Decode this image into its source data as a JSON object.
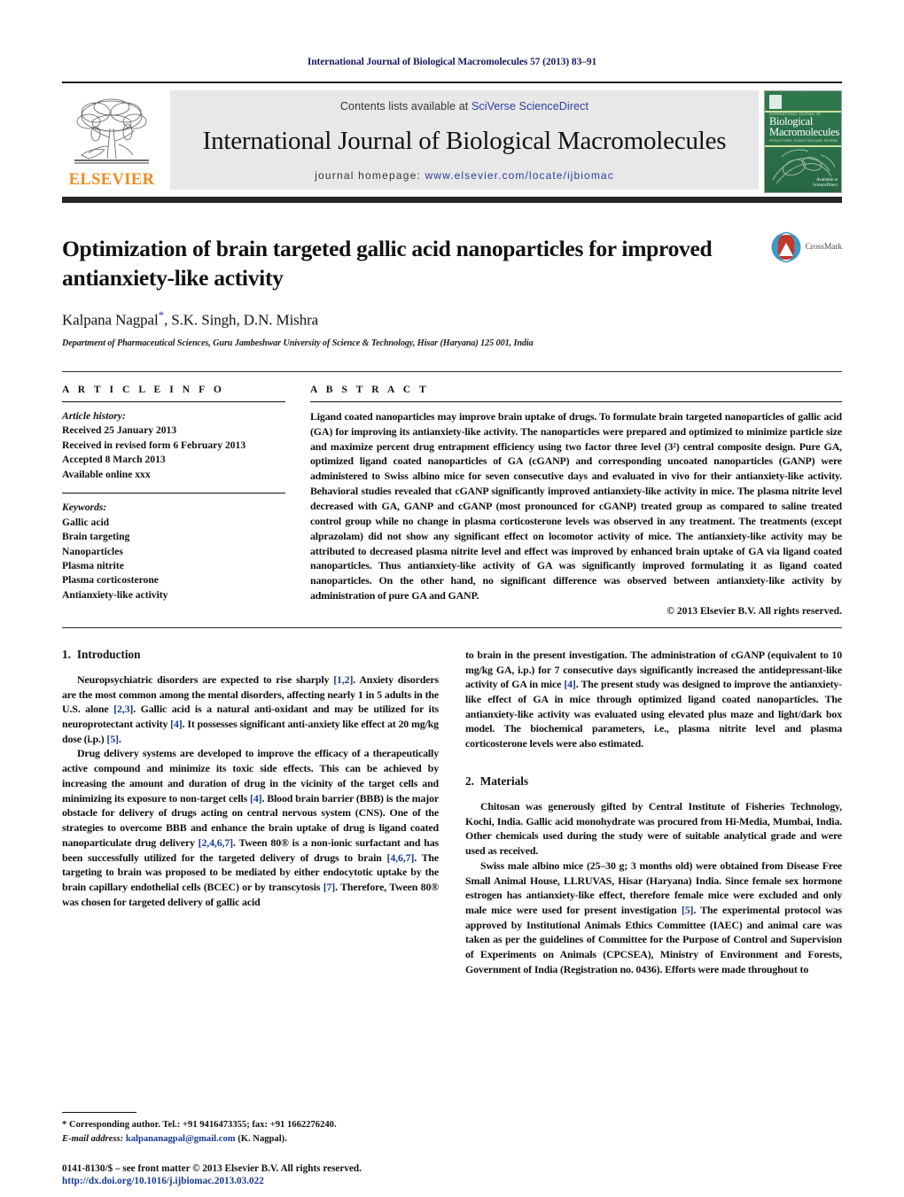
{
  "running_head": "International Journal of Biological Macromolecules 57 (2013) 83–91",
  "masthead": {
    "publisher_name": "ELSEVIER",
    "contents_prefix": "Contents lists available at ",
    "contents_link": "SciVerse ScienceDirect",
    "journal_title": "International Journal of Biological Macromolecules",
    "homepage_prefix": "journal homepage: ",
    "homepage_link": "www.elsevier.com/locate/ijbiomac",
    "cover": {
      "top_line": "INTERNATIONAL JOURNAL OF",
      "name_line1": "Biological",
      "name_line2": "Macromolecules",
      "sub_line": "STRUCTURE, FUNCTION AND INTERACTIONS",
      "badge_line1": "Available at",
      "badge_line2": "ScienceDirect"
    }
  },
  "article": {
    "title": "Optimization of brain targeted gallic acid nanoparticles for improved antianxiety-like activity",
    "authors_pre": "Kalpana Nagpal",
    "authors_post": ", S.K. Singh, D.N. Mishra",
    "affiliation": "Department of Pharmaceutical Sciences, Guru Jambeshwar University of Science & Technology, Hisar (Haryana) 125 001, India",
    "crossmark_label": "CrossMark"
  },
  "article_info": {
    "heading": "A R T I C L E   I N F O",
    "history_label": "Article history:",
    "history": [
      "Received 25 January 2013",
      "Received in revised form 6 February 2013",
      "Accepted 8 March 2013",
      "Available online xxx"
    ],
    "keywords_label": "Keywords:",
    "keywords": [
      "Gallic acid",
      "Brain targeting",
      "Nanoparticles",
      "Plasma nitrite",
      "Plasma corticosterone",
      "Antianxiety-like activity"
    ]
  },
  "abstract": {
    "heading": "A B S T R A C T",
    "text": "Ligand coated nanoparticles may improve brain uptake of drugs. To formulate brain targeted nanoparticles of gallic acid (GA) for improving its antianxiety-like activity. The nanoparticles were prepared and optimized to minimize particle size and maximize percent drug entrapment efficiency using two factor three level (3²) central composite design. Pure GA, optimized ligand coated nanoparticles of GA (cGANP) and corresponding uncoated nanoparticles (GANP) were administered to Swiss albino mice for seven consecutive days and evaluated in vivo for their antianxiety-like activity. Behavioral studies revealed that cGANP significantly improved antianxiety-like activity in mice. The plasma nitrite level decreased with GA, GANP and cGANP (most pronounced for cGANP) treated group as compared to saline treated control group while no change in plasma corticosterone levels was observed in any treatment. The treatments (except alprazolam) did not show any significant effect on locomotor activity of mice. The antianxiety-like activity may be attributed to decreased plasma nitrite level and effect was improved by enhanced brain uptake of GA via ligand coated nanoparticles. Thus antianxiety-like activity of GA was significantly improved formulating it as ligand coated nanoparticles. On the other hand, no significant difference was observed between antianxiety-like activity by administration of pure GA and GANP.",
    "copyright": "© 2013 Elsevier B.V. All rights reserved."
  },
  "sections": {
    "introduction": {
      "number": "1.",
      "title": "Introduction",
      "p1_a": "Neuropsychiatric disorders are expected to rise sharply ",
      "p1_r1": "[1,2]",
      "p1_b": ". Anxiety disorders are the most common among the mental disorders, affecting nearly 1 in 5 adults in the U.S. alone ",
      "p1_r2": "[2,3]",
      "p1_c": ". Gallic acid is a natural anti-oxidant and may be utilized for its neuroprotectant activity ",
      "p1_r3": "[4]",
      "p1_d": ". It possesses significant anti-anxiety like effect at 20 mg/kg dose (i.p.) ",
      "p1_r4": "[5]",
      "p1_e": ".",
      "p2_a": "Drug delivery systems are developed to improve the efficacy of a therapeutically active compound and minimize its toxic side effects. This can be achieved by increasing the amount and duration of drug in the vicinity of the target cells and minimizing its exposure to non-target cells ",
      "p2_r1": "[4]",
      "p2_b": ". Blood brain barrier (BBB) is the major obstacle for delivery of drugs acting on central nervous system (CNS). One of the strategies to overcome BBB and enhance the brain uptake of drug is ligand coated nanoparticulate drug delivery ",
      "p2_r2": "[2,4,6,7]",
      "p2_c": ". Tween 80® is a non-ionic surfactant and has been successfully utilized for the targeted delivery of drugs to brain ",
      "p2_r3": "[4,6,7]",
      "p2_d": ". The targeting to brain was proposed to be mediated by either endocytotic uptake by the brain capillary endothelial cells (BCEC) or by transcytosis ",
      "p2_r4": "[7]",
      "p2_e": ". Therefore, Tween 80® was chosen for targeted delivery of gallic acid",
      "p3_a": "to brain in the present investigation. The administration of cGANP (equivalent to 10 mg/kg GA, i.p.) for 7 consecutive days significantly increased the antidepressant-like activity of GA in mice ",
      "p3_r1": "[4]",
      "p3_b": ". The present study was designed to improve the antianxiety-like effect of GA in mice through optimized ligand coated nanoparticles. The antianxiety-like activity was evaluated using elevated plus maze and light/dark box model. The biochemical parameters, i.e., plasma nitrite level and plasma corticosterone levels were also estimated."
    },
    "materials": {
      "number": "2.",
      "title": "Materials",
      "p1": "Chitosan was generously gifted by Central Institute of Fisheries Technology, Kochi, India. Gallic acid monohydrate was procured from Hi-Media, Mumbai, India. Other chemicals used during the study were of suitable analytical grade and were used as received.",
      "p2_a": "Swiss male albino mice (25–30 g; 3 months old) were obtained from Disease Free Small Animal House, LLRUVAS, Hisar (Haryana) India. Since female sex hormone estrogen has antianxiety-like effect, therefore female mice were excluded and only male mice were used for present investigation ",
      "p2_r1": "[5]",
      "p2_b": ". The experimental protocol was approved by Institutional Animals Ethics Committee (IAEC) and animal care was taken as per the guidelines of Committee for the Purpose of Control and Supervision of Experiments on Animals (CPCSEA), Ministry of Environment and Forests, Government of India (Registration no. 0436). Efforts were made throughout to"
    }
  },
  "footnote": {
    "corresponding": "* Corresponding author. Tel.: +91 9416473355; fax: +91 1662276240.",
    "email_label": "E-mail address:",
    "email": "kalpananagpal@gmail.com",
    "email_suffix": " (K. Nagpal)."
  },
  "footer": {
    "line1": "0141-8130/$ – see front matter © 2013 Elsevier B.V. All rights reserved.",
    "doi": "http://dx.doi.org/10.1016/j.ijbiomac.2013.03.022"
  },
  "colors": {
    "link_blue": "#2b3b9e",
    "ref_blue": "#1a3a8f",
    "elsevier_orange": "#F08A1E",
    "cover_green": "#2b7049",
    "runhead_navy": "#1a1a5e"
  }
}
